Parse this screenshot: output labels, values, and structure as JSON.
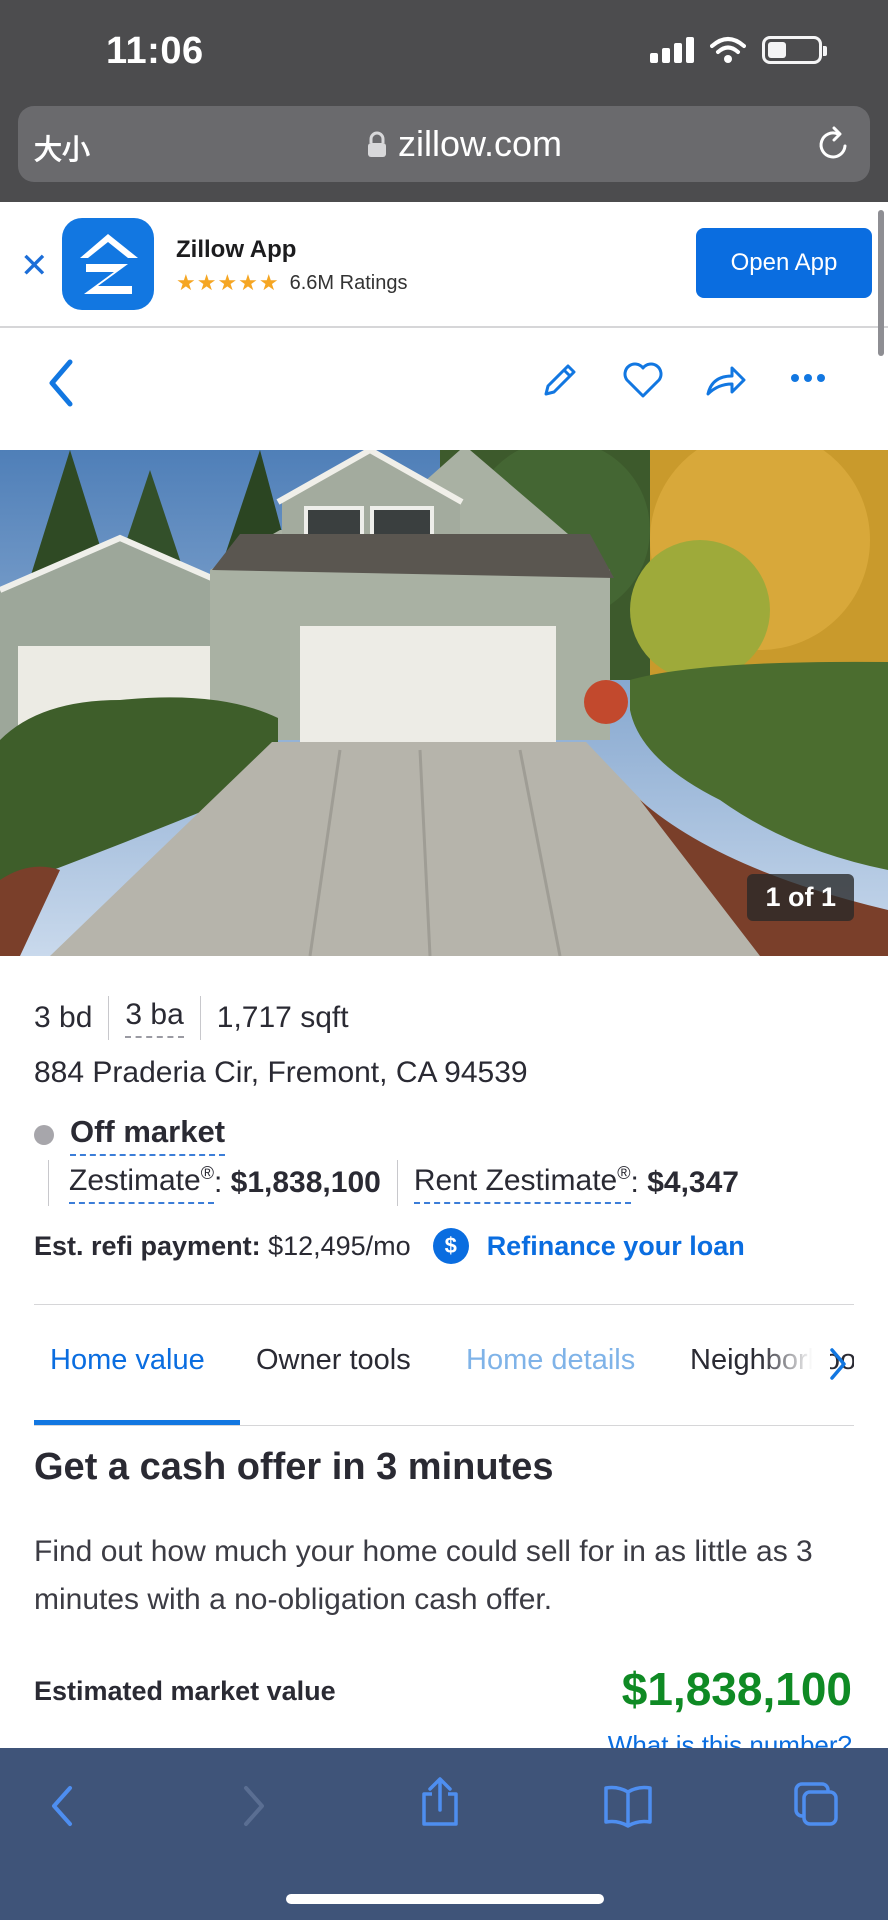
{
  "status_bar": {
    "time": "11:06"
  },
  "browser": {
    "text_size_label": "大小",
    "domain": "zillow.com"
  },
  "app_banner": {
    "app_name": "Zillow App",
    "ratings": "6.6M Ratings",
    "open_label": "Open App"
  },
  "photo": {
    "counter": "1 of 1"
  },
  "listing": {
    "beds": "3 bd",
    "baths": "3 ba",
    "sqft": "1,717 sqft",
    "address": "884 Praderia Cir, Fremont, CA 94539",
    "status": "Off market",
    "zestimate_label": "Zestimate",
    "zestimate_value": "$1,838,100",
    "rent_zestimate_label": "Rent Zestimate",
    "rent_zestimate_value": "$4,347",
    "registered": "®",
    "colon": ":",
    "refi_label": "Est. refi payment:",
    "refi_value": "$12,495/mo",
    "refi_link": "Refinance your loan",
    "dollar_glyph": "$"
  },
  "tabs": [
    {
      "label": "Home value",
      "active": true
    },
    {
      "label": "Owner tools"
    },
    {
      "label": "Home details"
    },
    {
      "label": "Neighborhood"
    }
  ],
  "content": {
    "title": "Get a cash offer in 3 minutes",
    "description": "Find out how much your home could sell for in as little as 3 minutes with a no-obligation cash offer.",
    "market_value_label": "Estimated market value",
    "market_value": "$1,838,100",
    "market_value_link": "What is this number?"
  },
  "colors": {
    "accent": "#0a6de0",
    "value_green": "#0f8a24",
    "chrome_top": "#4c4c4e",
    "chrome_bottom": "#3f5479"
  }
}
